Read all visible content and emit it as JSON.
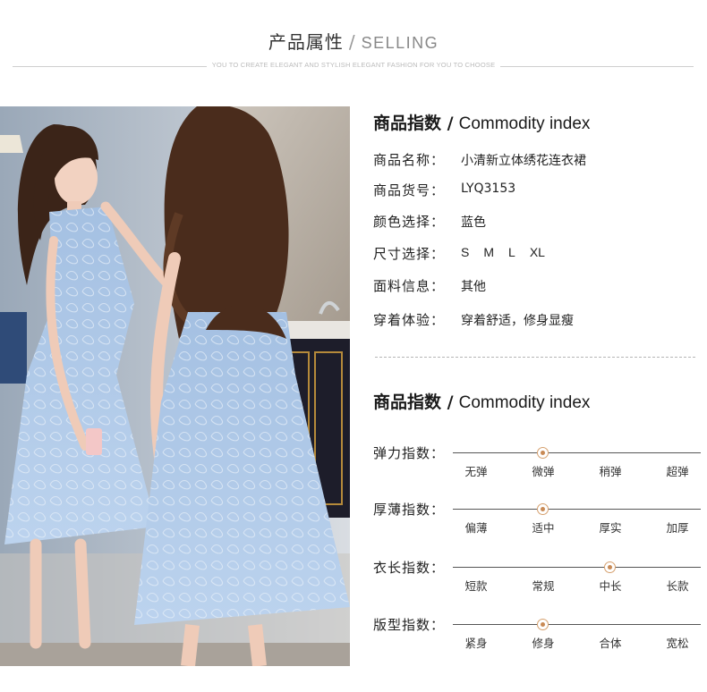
{
  "header": {
    "title_cn": "产品属性",
    "slash": "/",
    "title_en": "SELLING",
    "subtitle": "YOU TO CREATE ELEGANT AND STYLISH ELEGANT FASHION FOR YOU TO CHOOSE"
  },
  "info": {
    "title_cn": "商品指数 /",
    "title_en": "Commodity index",
    "rows": [
      {
        "label": "商品名称：",
        "value": "小清新立体绣花连衣裙"
      },
      {
        "label": "商品货号：",
        "value": "LYQ3153"
      },
      {
        "label": "颜色选择：",
        "value": "蓝色"
      },
      {
        "label": "尺寸选择：",
        "sizes": [
          "S",
          "M",
          "L",
          "XL"
        ]
      },
      {
        "label": "面料信息：",
        "value": "其他"
      },
      {
        "label": "穿着体验：",
        "value": "穿着舒适，修身显瘦"
      }
    ]
  },
  "index": {
    "title_cn": "商品指数 /",
    "title_en": "Commodity index",
    "scales": [
      {
        "label": "弹力指数：",
        "options": [
          "无弹",
          "微弹",
          "稍弹",
          "超弹"
        ],
        "selected": 1
      },
      {
        "label": "厚薄指数：",
        "options": [
          "偏薄",
          "适中",
          "厚实",
          "加厚"
        ],
        "selected": 1
      },
      {
        "label": "衣长指数：",
        "options": [
          "短款",
          "常规",
          "中长",
          "长款"
        ],
        "selected": 2
      },
      {
        "label": "版型指数：",
        "options": [
          "紧身",
          "修身",
          "合体",
          "宽松"
        ],
        "selected": 1
      }
    ]
  },
  "colors": {
    "accent_dot": "#c98a55",
    "dress": "#a9c6e6",
    "hair": "#4a2c1c"
  }
}
